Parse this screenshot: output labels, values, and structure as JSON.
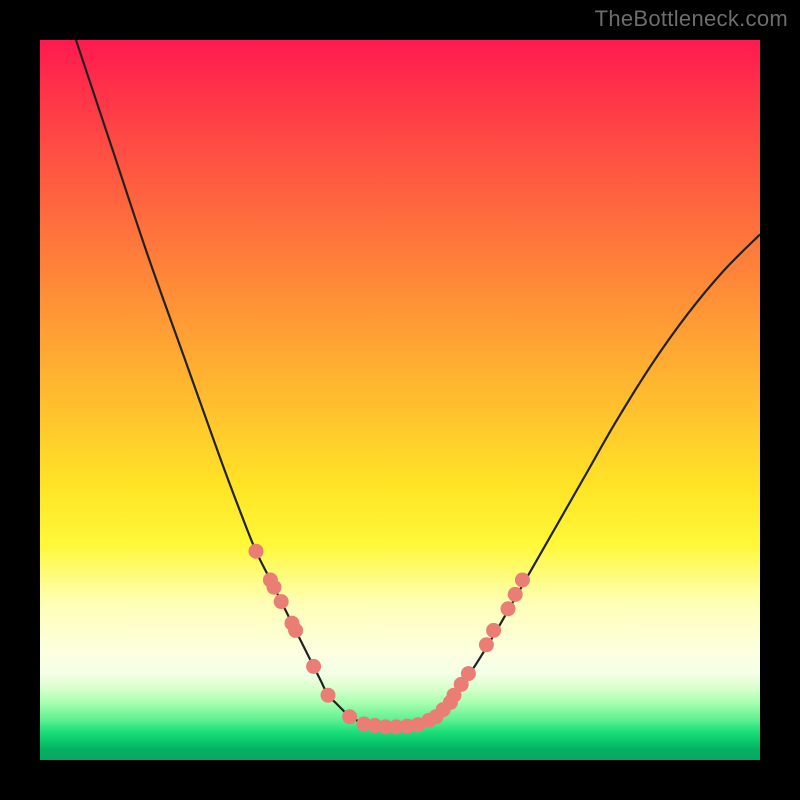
{
  "watermark": "TheBottleneck.com",
  "colors": {
    "background": "#000000",
    "curve": "#222222",
    "marker_fill": "#ea7d74",
    "marker_stroke": "#ea7d74",
    "gradient_top": "#ff1a50",
    "gradient_bottom": "#06a864"
  },
  "chart_data": {
    "type": "line",
    "title": "",
    "xlabel": "",
    "ylabel": "",
    "xlim": [
      0,
      100
    ],
    "ylim": [
      0,
      100
    ],
    "grid": false,
    "legend": false,
    "series": [
      {
        "name": "bottleneck-curve-left",
        "comment": "Left descending branch of the V-curve",
        "x": [
          5,
          10,
          15,
          20,
          25,
          28,
          30,
          32,
          34,
          35.5,
          37,
          38,
          39,
          40,
          41,
          42,
          43,
          44,
          45
        ],
        "y": [
          100,
          85,
          70,
          56,
          42,
          34,
          29,
          25,
          21,
          18,
          15,
          13,
          11,
          9,
          8,
          7,
          6,
          5.5,
          5
        ]
      },
      {
        "name": "bottleneck-curve-flat",
        "comment": "Flat bottom of the V around the optimum",
        "x": [
          45,
          46,
          47,
          48,
          49,
          50,
          51,
          52,
          53
        ],
        "y": [
          5,
          4.8,
          4.7,
          4.6,
          4.6,
          4.6,
          4.7,
          4.8,
          5
        ]
      },
      {
        "name": "bottleneck-curve-right",
        "comment": "Right ascending branch of the V-curve",
        "x": [
          53,
          55,
          57,
          59,
          61,
          64,
          68,
          72,
          76,
          80,
          85,
          90,
          95,
          100
        ],
        "y": [
          5,
          6,
          8,
          11,
          14,
          19,
          26,
          33,
          40,
          47,
          55,
          62,
          68,
          73
        ]
      }
    ],
    "markers": {
      "name": "highlighted-data-points",
      "comment": "Salmon dots clustered along the lower V",
      "points": [
        {
          "x": 30,
          "y": 29
        },
        {
          "x": 32,
          "y": 25
        },
        {
          "x": 32.5,
          "y": 24
        },
        {
          "x": 33.5,
          "y": 22
        },
        {
          "x": 35,
          "y": 19
        },
        {
          "x": 35.5,
          "y": 18
        },
        {
          "x": 38,
          "y": 13
        },
        {
          "x": 40,
          "y": 9
        },
        {
          "x": 43,
          "y": 6
        },
        {
          "x": 45,
          "y": 5
        },
        {
          "x": 46.5,
          "y": 4.8
        },
        {
          "x": 48,
          "y": 4.6
        },
        {
          "x": 49.5,
          "y": 4.6
        },
        {
          "x": 51,
          "y": 4.7
        },
        {
          "x": 52.5,
          "y": 4.9
        },
        {
          "x": 54,
          "y": 5.5
        },
        {
          "x": 55,
          "y": 6
        },
        {
          "x": 56,
          "y": 7
        },
        {
          "x": 57,
          "y": 8
        },
        {
          "x": 57.5,
          "y": 9
        },
        {
          "x": 58.5,
          "y": 10.5
        },
        {
          "x": 59.5,
          "y": 12
        },
        {
          "x": 62,
          "y": 16
        },
        {
          "x": 63,
          "y": 18
        },
        {
          "x": 65,
          "y": 21
        },
        {
          "x": 66,
          "y": 23
        },
        {
          "x": 67,
          "y": 25
        }
      ]
    }
  }
}
